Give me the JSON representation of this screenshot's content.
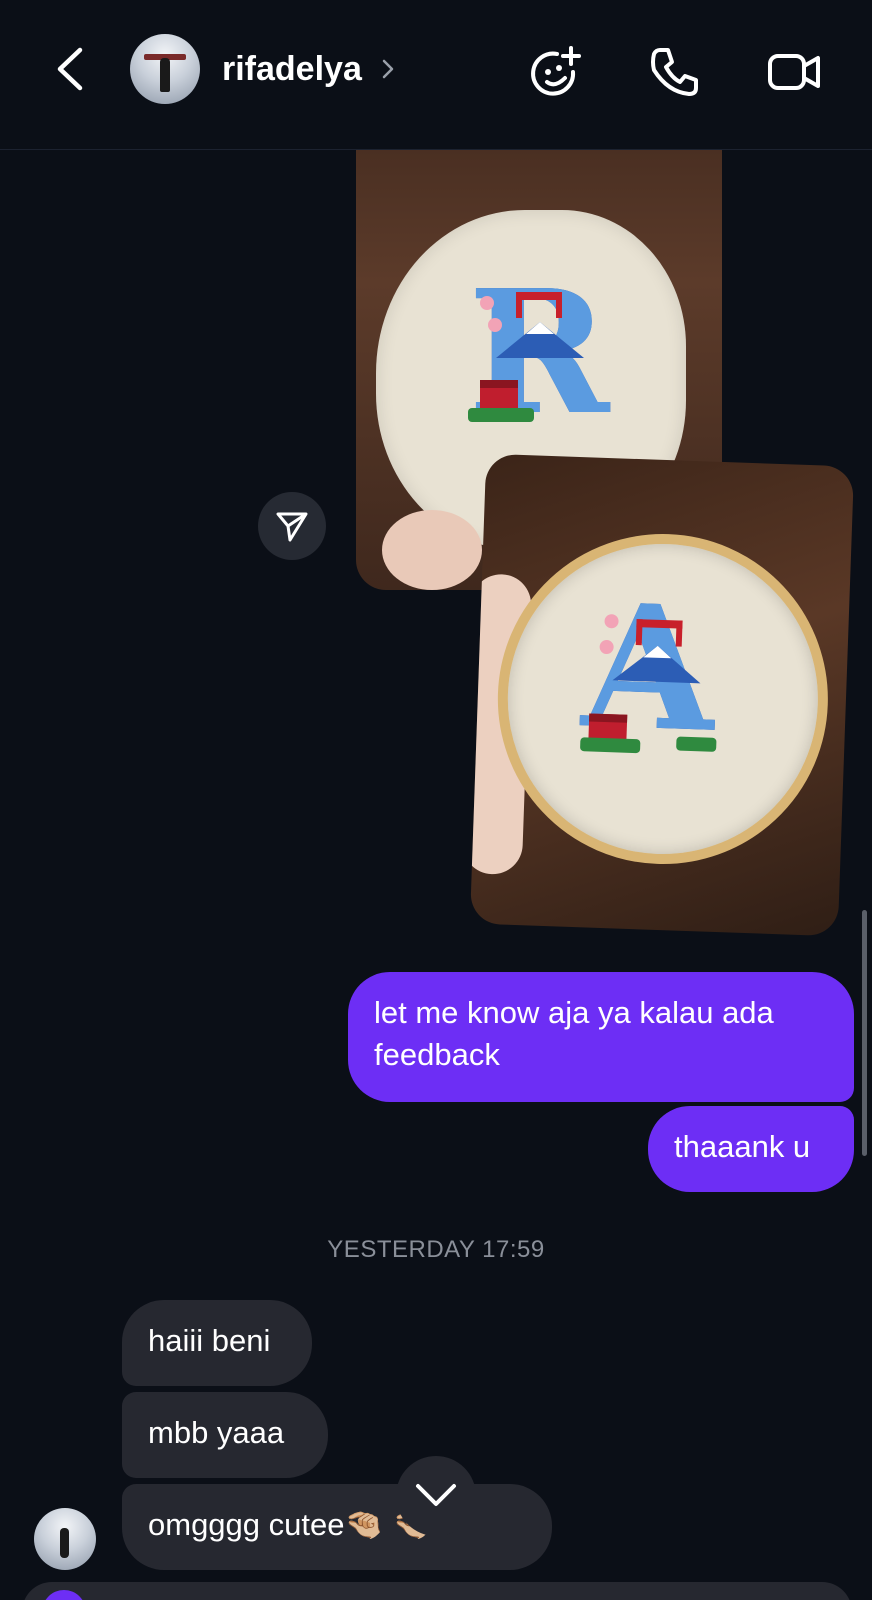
{
  "header": {
    "username": "rifadelya"
  },
  "timestamp": "YESTERDAY 17:59",
  "messages": {
    "outgoing": [
      "let me know aja ya kalau ada feedback",
      "thaaank u"
    ],
    "incoming": [
      "haiii beni",
      "mbb yaaa",
      "omgggg cutee"
    ],
    "incoming_emoji": "🤏🏼 🤏🏼"
  },
  "photos": {
    "photo1_letter": "R",
    "photo2_letter": "A"
  },
  "colors": {
    "background": "#0b0f17",
    "outgoing_bubble": "#6d2ef5",
    "incoming_bubble": "#262830",
    "timestamp": "#8a8f99"
  },
  "icons": {
    "back": "chevron-left-icon",
    "effects": "face-plus-icon",
    "call": "phone-icon",
    "video": "video-camera-icon",
    "share": "send-icon",
    "scroll": "chevron-down-icon"
  }
}
